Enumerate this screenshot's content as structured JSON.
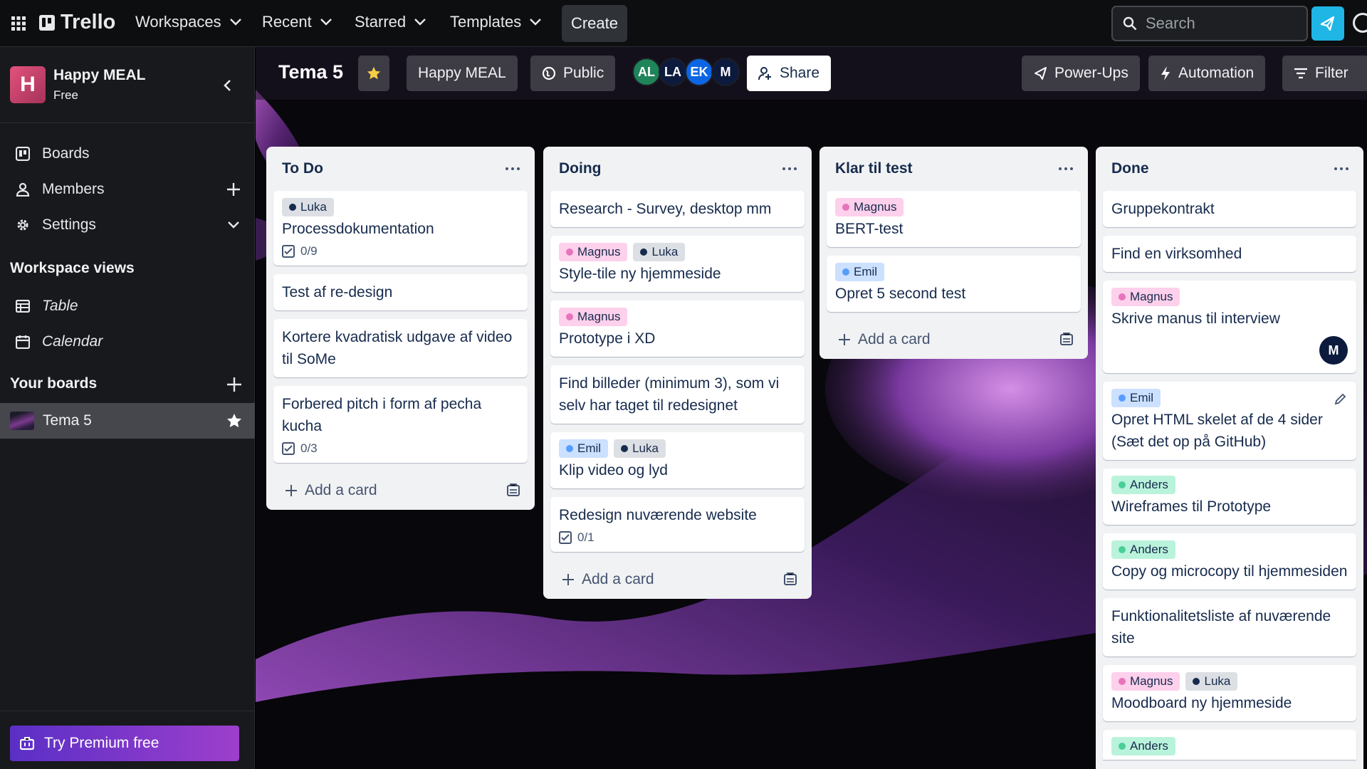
{
  "topbar": {
    "logo_text": "Trello",
    "nav": [
      {
        "label": "Workspaces"
      },
      {
        "label": "Recent"
      },
      {
        "label": "Starred"
      },
      {
        "label": "Templates"
      }
    ],
    "create_label": "Create",
    "search_placeholder": "Search"
  },
  "sidebar": {
    "workspace_initial": "H",
    "workspace_name": "Happy MEAL",
    "workspace_plan": "Free",
    "items": [
      {
        "label": "Boards",
        "icon": "trello-board-icon"
      },
      {
        "label": "Members",
        "icon": "person-icon"
      },
      {
        "label": "Settings",
        "icon": "gear-icon"
      }
    ],
    "workspace_views_heading": "Workspace views",
    "views": [
      {
        "label": "Table",
        "icon": "table-icon"
      },
      {
        "label": "Calendar",
        "icon": "calendar-icon"
      }
    ],
    "your_boards_heading": "Your boards",
    "boards": [
      {
        "label": "Tema 5",
        "starred": true
      }
    ],
    "premium_label": "Try Premium free"
  },
  "board": {
    "title": "Tema 5",
    "workspace_label": "Happy MEAL",
    "visibility_label": "Public",
    "members": [
      {
        "initials": "AL",
        "color": "#1f845a"
      },
      {
        "initials": "LA",
        "color": "#0c1a3d"
      },
      {
        "initials": "EK",
        "color": "#0c66e4"
      },
      {
        "initials": "M",
        "color": "#0c1a3d"
      }
    ],
    "share_label": "Share",
    "powerups_label": "Power-Ups",
    "automation_label": "Automation",
    "filter_label": "Filter",
    "add_card_label": "Add a card"
  },
  "lists": [
    {
      "title": "To Do",
      "cards": [
        {
          "labels": [
            "Luka"
          ],
          "title": "Processdokumentation",
          "checklist": "0/9"
        },
        {
          "labels": [],
          "title": "Test af re-design"
        },
        {
          "labels": [],
          "title": "Kortere kvadratisk udgave af video til SoMe"
        },
        {
          "labels": [],
          "title": "Forbered pitch i form af pecha kucha",
          "checklist": "0/3"
        }
      ]
    },
    {
      "title": "Doing",
      "cards": [
        {
          "labels": [],
          "title": "Research - Survey, desktop mm"
        },
        {
          "labels": [
            "Magnus",
            "Luka"
          ],
          "title": "Style-tile ny hjemmeside"
        },
        {
          "labels": [
            "Magnus"
          ],
          "title": "Prototype i XD"
        },
        {
          "labels": [],
          "title": "Find billeder (minimum 3), som vi selv har taget til redesignet"
        },
        {
          "labels": [
            "Emil",
            "Luka"
          ],
          "title": "Klip video og lyd"
        },
        {
          "labels": [],
          "title": "Redesign nuværende website",
          "checklist": "0/1"
        }
      ]
    },
    {
      "title": "Klar til test",
      "cards": [
        {
          "labels": [
            "Magnus"
          ],
          "title": "BERT-test"
        },
        {
          "labels": [
            "Emil"
          ],
          "title": "Opret 5 second test"
        }
      ]
    },
    {
      "title": "Done",
      "cards": [
        {
          "labels": [],
          "title": "Gruppekontrakt"
        },
        {
          "labels": [],
          "title": "Find en virksomhed"
        },
        {
          "labels": [
            "Magnus"
          ],
          "title": "Skrive manus til interview",
          "member": "M"
        },
        {
          "labels": [
            "Emil"
          ],
          "title": "Opret HTML skelet af de 4 sider (Sæt det op på GitHub)",
          "edit": true
        },
        {
          "labels": [
            "Anders"
          ],
          "title": "Wireframes til Prototype"
        },
        {
          "labels": [
            "Anders"
          ],
          "title": "Copy og microcopy til hjemmesiden"
        },
        {
          "labels": [],
          "title": "Funktionalitetsliste af nuværende site"
        },
        {
          "labels": [
            "Magnus",
            "Luka"
          ],
          "title": "Moodboard ny hjemmeside"
        },
        {
          "labels": [
            "Anders"
          ],
          "title": ""
        }
      ]
    }
  ],
  "label_colors": {
    "Luka": "#172b4d",
    "Magnus": "#e774bb",
    "Emil": "#579dff",
    "Anders": "#4bce97"
  }
}
